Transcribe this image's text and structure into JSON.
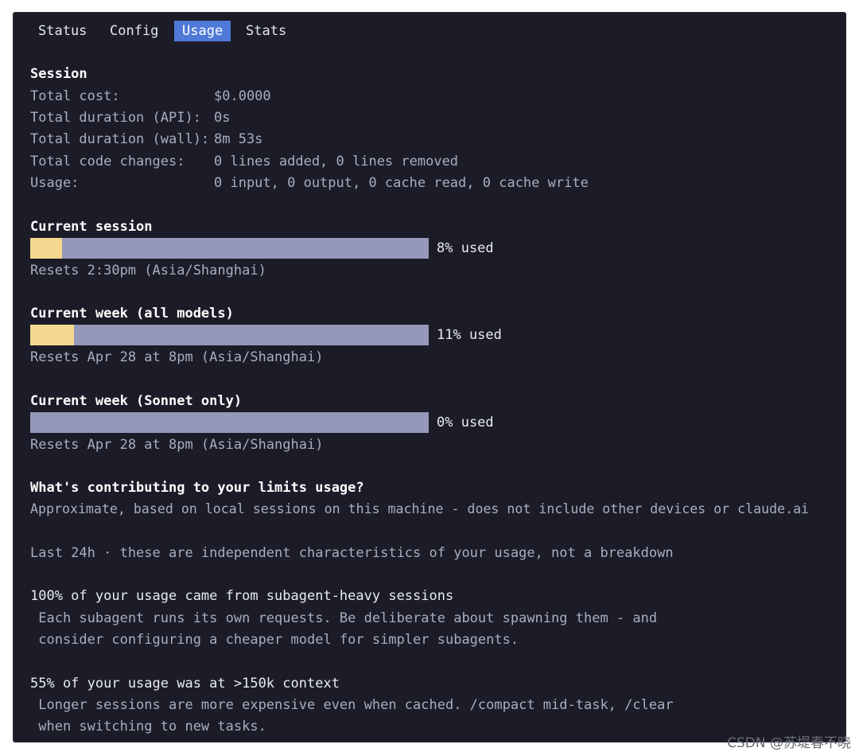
{
  "tabs": [
    "Status",
    "Config",
    "Usage",
    "Stats"
  ],
  "session": {
    "heading": "Session",
    "rows": [
      {
        "label": "Total cost:",
        "value": "$0.0000"
      },
      {
        "label": "Total duration (API):",
        "value": "0s"
      },
      {
        "label": "Total duration (wall):",
        "value": "8m 53s"
      },
      {
        "label": "Total code changes:",
        "value": "0 lines added, 0 lines removed"
      },
      {
        "label": "Usage:",
        "value": "0 input, 0 output, 0 cache read, 0 cache write"
      }
    ]
  },
  "limits": [
    {
      "title": "Current session",
      "percent": 8,
      "used_label": "8% used",
      "resets": "Resets 2:30pm (Asia/Shanghai)"
    },
    {
      "title": "Current week (all models)",
      "percent": 11,
      "used_label": "11% used",
      "resets": "Resets Apr 28 at 8pm (Asia/Shanghai)"
    },
    {
      "title": "Current week (Sonnet only)",
      "percent": 0,
      "used_label": "0% used",
      "resets": "Resets Apr 28 at 8pm (Asia/Shanghai)"
    }
  ],
  "contrib": {
    "heading": "What's contributing to your limits usage?",
    "subtitle": "Approximate, based on local sessions on this machine - does not include other devices or claude.ai",
    "period": "Last 24h · these are independent characteristics of your usage, not a breakdown",
    "items": [
      {
        "title": "100% of your usage came from subagent-heavy sessions",
        "line1": " Each subagent runs its own requests. Be deliberate about spawning them - and",
        "line2": " consider configuring a cheaper model for simpler subagents."
      },
      {
        "title": "55% of your usage was at >150k context",
        "line1": " Longer sessions are more expensive even when cached. /compact mid-task, /clear",
        "line2": " when switching to new tasks."
      }
    ]
  },
  "watermark": "CSDN @苏堤春不晓",
  "colors": {
    "background": "#1b1c27",
    "accent": "#4f79d8",
    "bar_track": "#9598b8",
    "bar_fill": "#f5d88f"
  }
}
